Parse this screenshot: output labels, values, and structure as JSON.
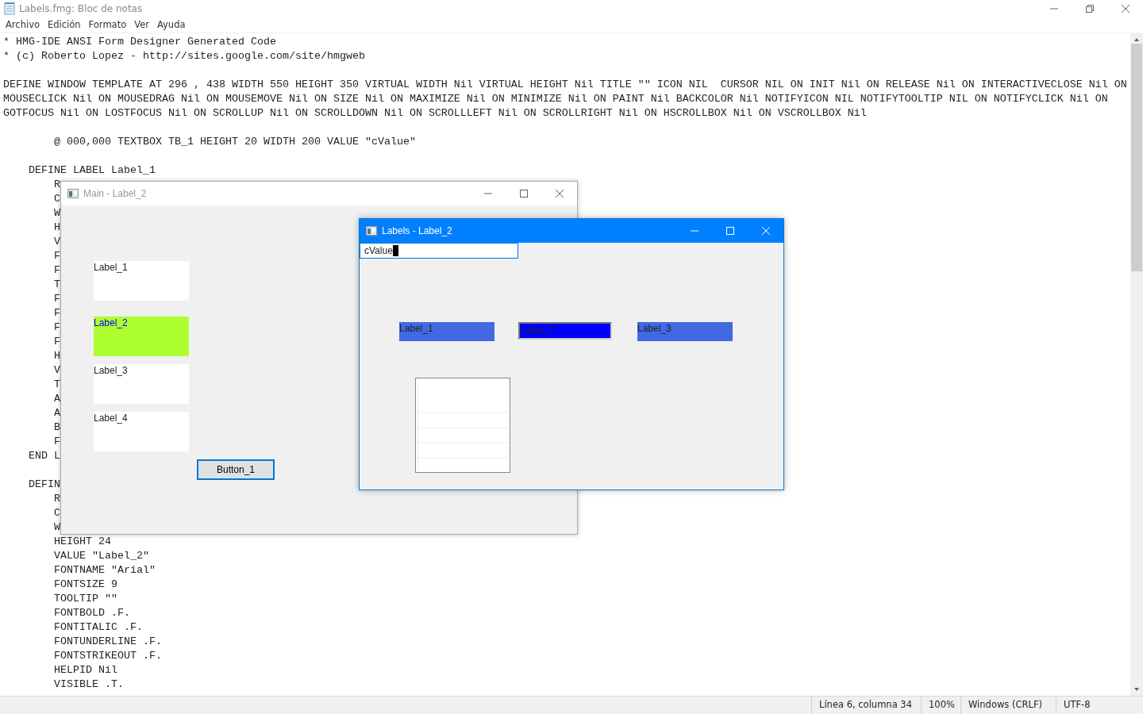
{
  "notepad": {
    "title": "Labels.fmg: Bloc de notas",
    "menu": [
      "Archivo",
      "Edición",
      "Formato",
      "Ver",
      "Ayuda"
    ],
    "blocks": [
      {
        "lines": [
          "* HMG-IDE ANSI Form Designer Generated Code",
          "* (c) Roberto Lopez - http://sites.google.com/site/hmgweb"
        ]
      },
      {
        "lines": [
          "DEFINE WINDOW TEMPLATE AT 296 , 438 WIDTH 550 HEIGHT 350 VIRTUAL WIDTH Nil VIRTUAL HEIGHT Nil TITLE \"\" ICON NIL  CURSOR NIL ON INIT Nil ON RELEASE Nil ON INTERACTIVECLOSE Nil ON",
          "MOUSECLICK Nil ON MOUSEDRAG Nil ON MOUSEMOVE Nil ON SIZE Nil ON MAXIMIZE Nil ON MINIMIZE Nil ON PAINT Nil BACKCOLOR Nil NOTIFYICON NIL NOTIFYTOOLTIP NIL ON NOTIFYCLICK Nil ON",
          "GOTFOCUS Nil ON LOSTFOCUS Nil ON SCROLLUP Nil ON SCROLLDOWN Nil ON SCROLLLEFT Nil ON SCROLLRIGHT Nil ON HSCROLLBOX Nil ON VSCROLLBOX Nil"
        ]
      },
      {
        "lines": [
          "        @ 000,000 TEXTBOX TB_1 HEIGHT 20 WIDTH 200 VALUE \"cValue\""
        ]
      },
      {
        "lines": [
          "    DEFINE LABEL Label_1",
          "        R",
          "        C",
          "        W",
          "        H",
          "        V",
          "        F",
          "        F",
          "        T",
          "        F",
          "        F",
          "        F",
          "        F",
          "        H",
          "        V",
          "        T",
          "        A",
          "        A",
          "        B",
          "        F",
          "    END L"
        ]
      },
      {
        "lines": [
          "    DEFIN",
          "        R",
          "        C",
          "        W",
          "        HEIGHT 24",
          "        VALUE \"Label_2\"",
          "        FONTNAME \"Arial\"",
          "        FONTSIZE 9",
          "        TOOLTIP \"\"",
          "        FONTBOLD .F.",
          "        FONTITALIC .F.",
          "        FONTUNDERLINE .F.",
          "        FONTSTRIKEOUT .F.",
          "        HELPID Nil",
          "        VISIBLE .T."
        ]
      }
    ],
    "status_bar": [
      "Línea 6, columna 34",
      "100%",
      "Windows (CRLF)",
      "UTF-8"
    ]
  },
  "windows": [
    {
      "title": "Main - Label_2",
      "active": false,
      "labels": [
        {
          "text": "Label_1",
          "color": "#ffffff",
          "selected": false
        },
        {
          "text": "Label_2",
          "color": "#adff2f",
          "selected": true
        },
        {
          "text": "Label_3",
          "color": "#ffffff",
          "selected": false
        },
        {
          "text": "Label_4",
          "color": "#ffffff",
          "selected": false
        }
      ],
      "button": "Button_1"
    },
    {
      "title": "Labels - Label_2",
      "active": true,
      "textbox": {
        "value": "cValue"
      },
      "labels": [
        {
          "text": "Label_1",
          "color": "#4169e1",
          "selected": false
        },
        {
          "text": "Label_2",
          "color": "#0000ff",
          "selected": true
        },
        {
          "text": "Label_3",
          "color": "#4169e1",
          "selected": false
        }
      ]
    }
  ]
}
